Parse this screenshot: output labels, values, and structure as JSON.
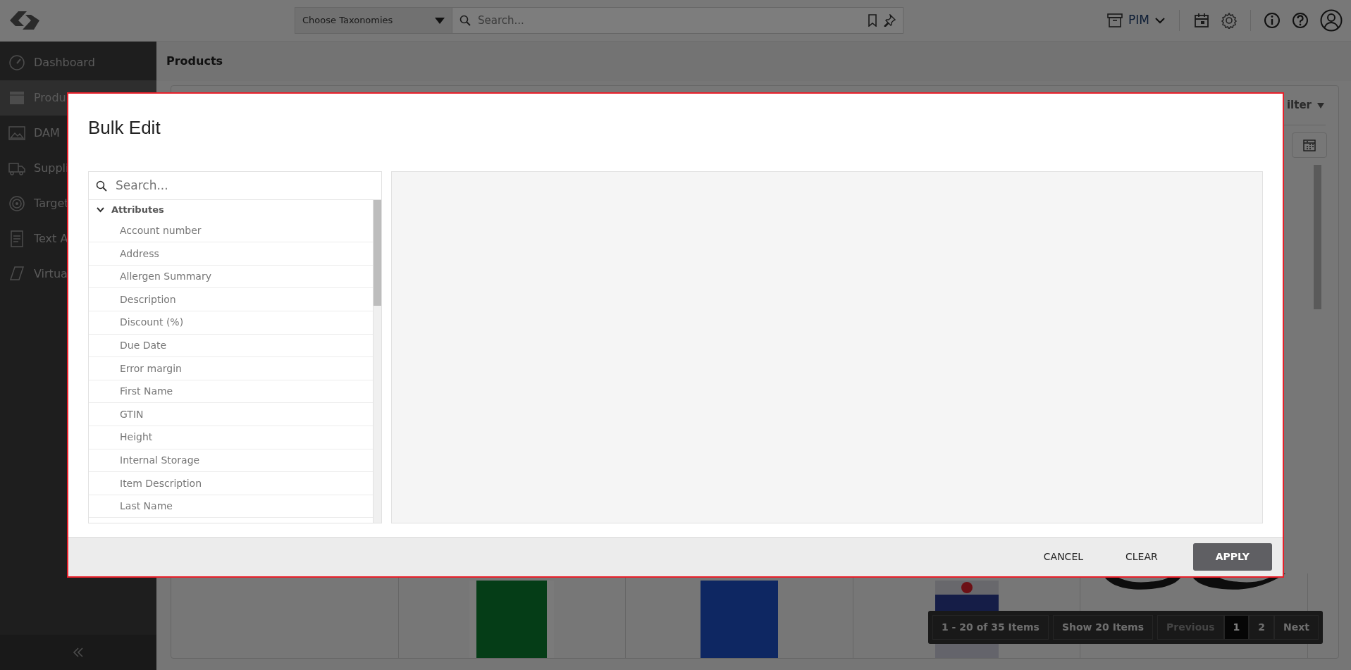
{
  "top_bar": {
    "taxonomy_dropdown": "Choose Taxonomies",
    "search": {
      "placeholder": "Search..."
    },
    "module": "PIM"
  },
  "sidebar": {
    "items": [
      {
        "label": "Dashboard",
        "selected": false
      },
      {
        "label": "Produ",
        "selected": true
      },
      {
        "label": "DAM",
        "selected": false
      },
      {
        "label": "Suppli",
        "selected": false
      },
      {
        "label": "Target",
        "selected": false
      },
      {
        "label": "Text A",
        "selected": false
      },
      {
        "label": "Virtua",
        "selected": false
      }
    ]
  },
  "page": {
    "title": "Products",
    "filter_label": "ilter",
    "product_cards": [
      {
        "kind": "empty"
      },
      {
        "kind": "picture"
      },
      {
        "kind": "picture"
      },
      {
        "kind": "picture"
      },
      {
        "kind": "picture"
      }
    ],
    "pagination": {
      "range": "1 - 20 of 35 Items",
      "page_size": "Show 20 Items",
      "previous": {
        "label": "Previous",
        "disabled": true
      },
      "pages": [
        {
          "label": "1",
          "selected": true
        },
        {
          "label": "2",
          "selected": false
        }
      ],
      "next": {
        "label": "Next",
        "disabled": false
      }
    }
  },
  "dialog": {
    "title": "Bulk Edit",
    "search": {
      "placeholder": "Search..."
    },
    "tree": [
      {
        "label": "Attributes",
        "expanded": true,
        "children": [
          {
            "label": "Account number"
          },
          {
            "label": "Address"
          },
          {
            "label": "Allergen Summary"
          },
          {
            "label": "Description"
          },
          {
            "label": "Discount (%)"
          },
          {
            "label": "Due Date"
          },
          {
            "label": "Error margin"
          },
          {
            "label": "First Name"
          },
          {
            "label": "GTIN"
          },
          {
            "label": "Height"
          },
          {
            "label": "Internal Storage"
          },
          {
            "label": "Item Description"
          },
          {
            "label": "Last Name"
          }
        ]
      }
    ],
    "buttons": [
      {
        "label": "CANCEL",
        "kind": "text"
      },
      {
        "label": "CLEAR",
        "kind": "text"
      },
      {
        "label": "APPLY",
        "kind": "primary"
      }
    ]
  }
}
